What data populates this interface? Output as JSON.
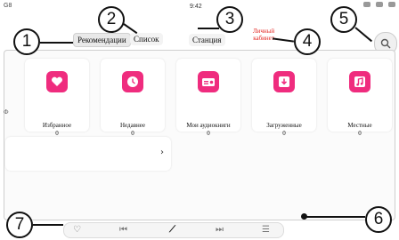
{
  "status": {
    "left": "G8",
    "time": "9:42"
  },
  "nav": {
    "recommendations": "Рекомендации",
    "list": "Список",
    "station": "Станция",
    "account": "Личный кабинет"
  },
  "cards": [
    {
      "label": "Избранное",
      "count": "0",
      "icon": "heart-icon"
    },
    {
      "label": "Недавнее",
      "count": "0",
      "icon": "clock-icon"
    },
    {
      "label": "Мои аудиокниги",
      "count": "0",
      "icon": "radio-icon"
    },
    {
      "label": "Загруженные",
      "count": "0",
      "icon": "download-icon"
    },
    {
      "label": "Местные",
      "count": "0",
      "icon": "music-note-icon"
    }
  ],
  "left_edge_text": "Ф",
  "callouts": [
    "1",
    "2",
    "3",
    "4",
    "5",
    "6",
    "7"
  ],
  "colors": {
    "accent": "#ef2c7e",
    "account_red": "#e2211c"
  }
}
